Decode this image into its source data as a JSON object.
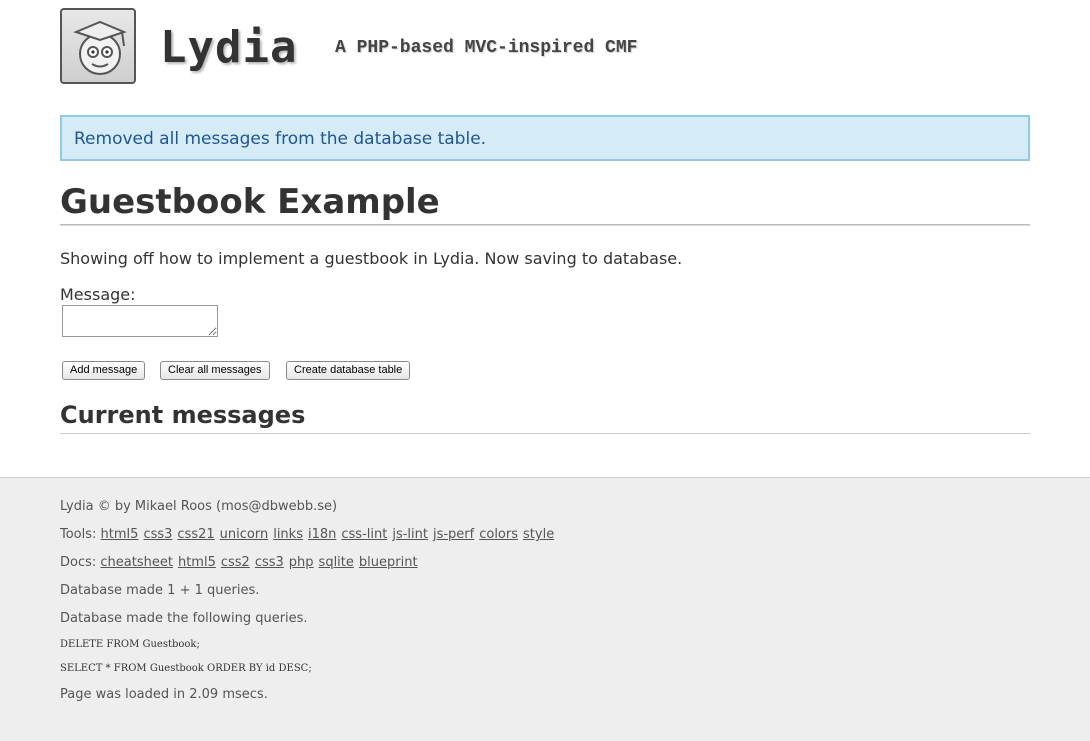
{
  "header": {
    "title": "Lydia",
    "slogan": "A PHP-based MVC-inspired CMF",
    "logo_icon": "graduate-face-logo"
  },
  "flash": {
    "text": "Removed all messages from the database table.",
    "color_bg": "#d5ebf6",
    "color_border": "#92cae4",
    "color_text": "#205791"
  },
  "main": {
    "heading": "Guestbook Example",
    "intro": "Showing off how to implement a guestbook in Lydia. Now saving to database.",
    "message_label": "Message:",
    "message_value": "",
    "buttons": {
      "add": "Add message",
      "clear": "Clear all messages",
      "create": "Create database table"
    },
    "current_heading": "Current messages"
  },
  "footer": {
    "copyright": "Lydia © by Mikael Roos (mos@dbwebb.se)",
    "tools_label": "Tools:",
    "tools": [
      "html5",
      "css3",
      "css21",
      "unicorn",
      "links",
      "i18n",
      "css-lint",
      "js-lint",
      "js-perf",
      "colors",
      "style"
    ],
    "docs_label": "Docs:",
    "docs": [
      "cheatsheet",
      "html5",
      "css2",
      "css3",
      "php",
      "sqlite",
      "blueprint"
    ],
    "db_count": "Database made 1 + 1 queries.",
    "db_following": "Database made the following queries.",
    "queries": [
      "DELETE FROM Guestbook;",
      "SELECT * FROM Guestbook ORDER BY id DESC;"
    ],
    "load_time": "Page was loaded in 2.09 msecs."
  }
}
